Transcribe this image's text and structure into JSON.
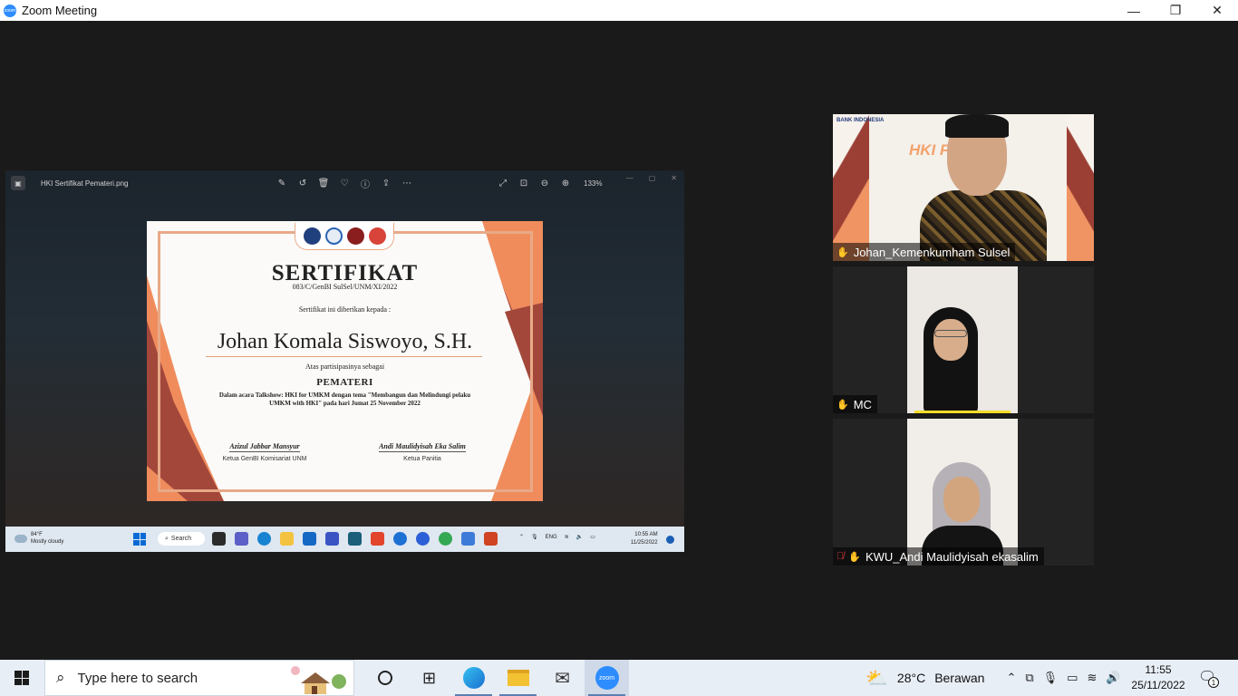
{
  "window": {
    "title": "Zoom Meeting",
    "minimize": "—",
    "restore": "❐",
    "close": "✕"
  },
  "shared_screen": {
    "viewer": {
      "file_name": "HKI Sertifikat Pemateri.png",
      "zoom_level": "133%"
    },
    "certificate": {
      "heading": "SERTIFIKAT",
      "number": "083/C/GenBI SulSel/UNM/XI/2022",
      "given_to": "Sertifikat ini diberikan kepada :",
      "recipient": "Johan Komala Siswoyo, S.H.",
      "participation": "Atas partisipasinya sebagai",
      "role": "PEMATERI",
      "description": "Dalam acara Talkshow:  HKI for UMKM dengan tema \"Membangun dan Melindungi pelaku UMKM with HKI\" pada hari Jumat 25 November 2022",
      "signer1_name": "Azizul Jabbar Mansyur",
      "signer1_role": "Ketua GenBI Komisariat UNM",
      "signer2_name": "Andi Maulidyisah Eka Salim",
      "signer2_role": "Ketua Panitia"
    },
    "taskbar": {
      "weather_temp": "84°F",
      "weather_desc": "Mostly cloudy",
      "search_label": "Search",
      "lang": "ENG",
      "time": "10:55 AM",
      "date": "11/25/2022"
    }
  },
  "participants": [
    {
      "name": "Johan_Kemenkumham Sulsel",
      "muted": false
    },
    {
      "name": "MC",
      "muted": false
    },
    {
      "name": "KWU_Andi Maulidyisah ekasalim",
      "muted": true
    }
  ],
  "tile_art": {
    "bank_logo": "BANK INDONESIA",
    "banner_text": "HKI Fo"
  },
  "taskbar": {
    "search_placeholder": "Type here to search",
    "temperature": "28°C",
    "weather": "Berawan",
    "time": "11:55",
    "date": "25/11/2022",
    "notification_count": "1"
  }
}
